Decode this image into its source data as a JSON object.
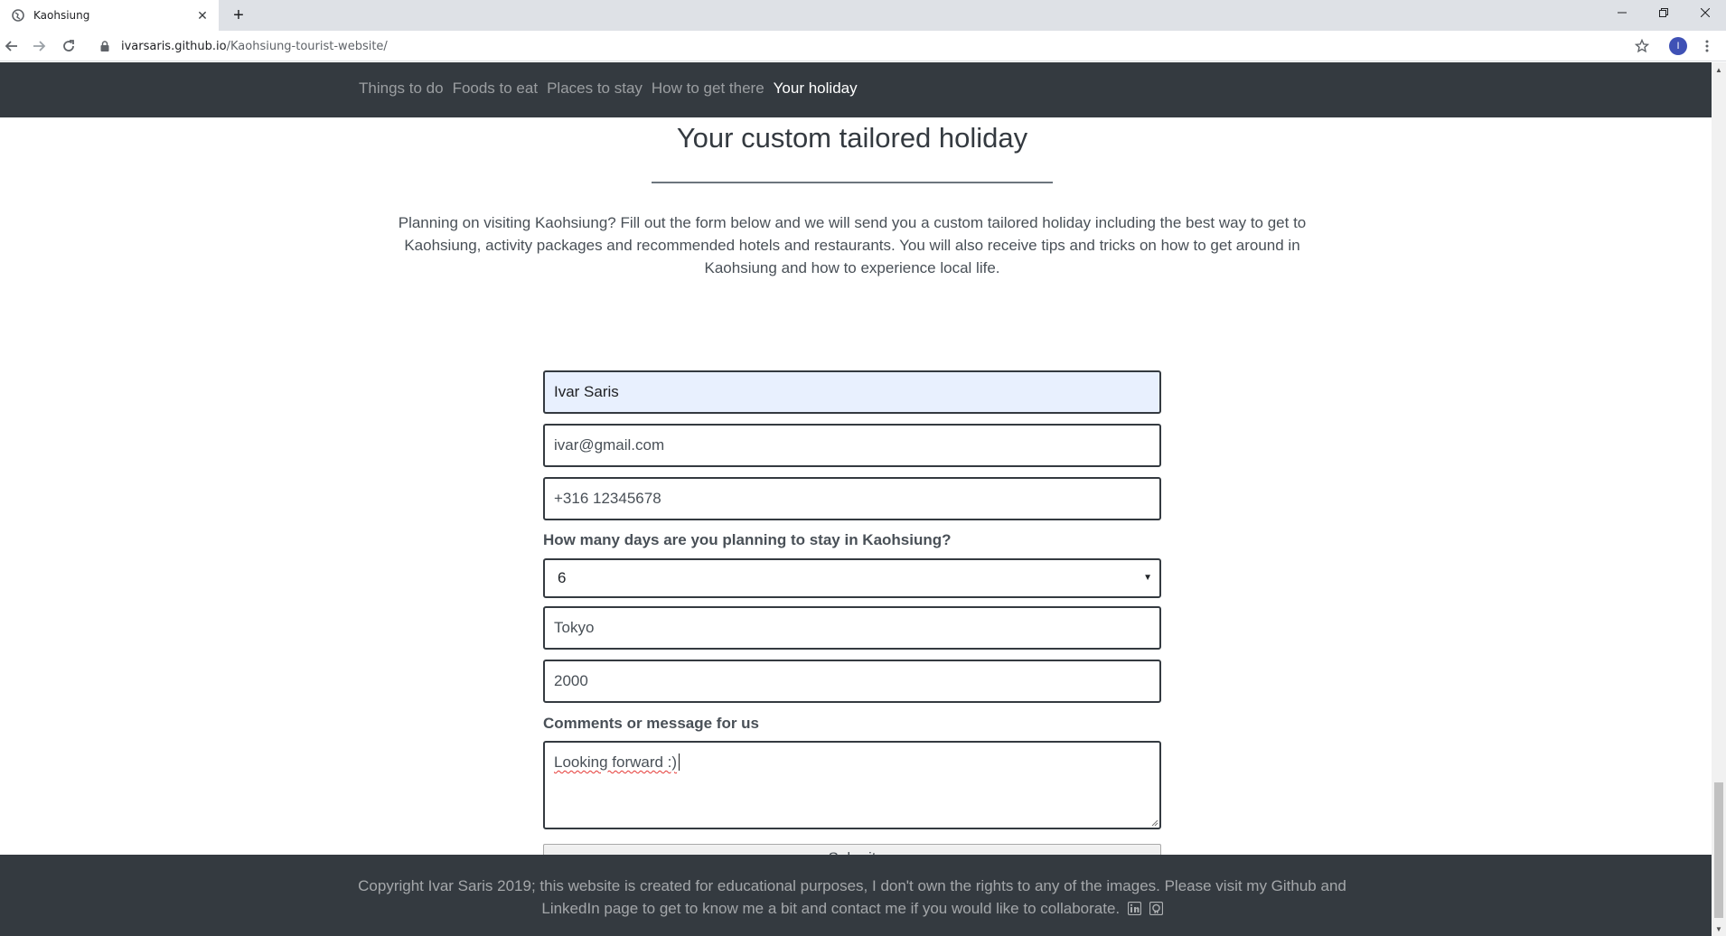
{
  "browser": {
    "tab_title": "Kaohsiung",
    "new_tab_label": "+",
    "url_host": "ivarsaris.github.io",
    "url_path": "/Kaohsiung-tourist-website/",
    "profile_initial": "I"
  },
  "nav": {
    "links": [
      "Things to do",
      "Foods to eat",
      "Places to stay",
      "How to get there",
      "Your holiday"
    ],
    "active_index": 4
  },
  "main": {
    "title": "Your custom tailored holiday",
    "intro": "Planning on visiting Kaohsiung? Fill out the form below and we will send you a custom tailored holiday including the best way to get to Kaohsiung, activity packages and recommended hotels and restaurants. You will also receive tips and tricks on how to get around in Kaohsiung and how to experience local life."
  },
  "form": {
    "name_value": "Ivar Saris",
    "email_value": "ivar@gmail.com",
    "phone_value": "+316 12345678",
    "days_label": "How many days are you planning to stay in Kaohsiung?",
    "days_value": "6",
    "origin_value": "Tokyo",
    "budget_value": "2000",
    "comments_label": "Comments or message for us",
    "comments_value": "Looking forward :)",
    "submit_label": "Submit"
  },
  "footer": {
    "text": "Copyright Ivar Saris 2019; this website is created for educational purposes, I don't own the rights to any of the images. Please visit my Github and LinkedIn page to get to know me a bit and contact me if you would like to collaborate."
  },
  "icons": {
    "favicon": "globe-icon",
    "lock": "lock-icon",
    "star": "bookmark-star-icon",
    "linkedin": "linkedin-icon",
    "github": "github-icon"
  },
  "colors": {
    "navbar": "#343a40",
    "autofill": "#e8f0fe",
    "tabstrip": "#dee1e6"
  }
}
